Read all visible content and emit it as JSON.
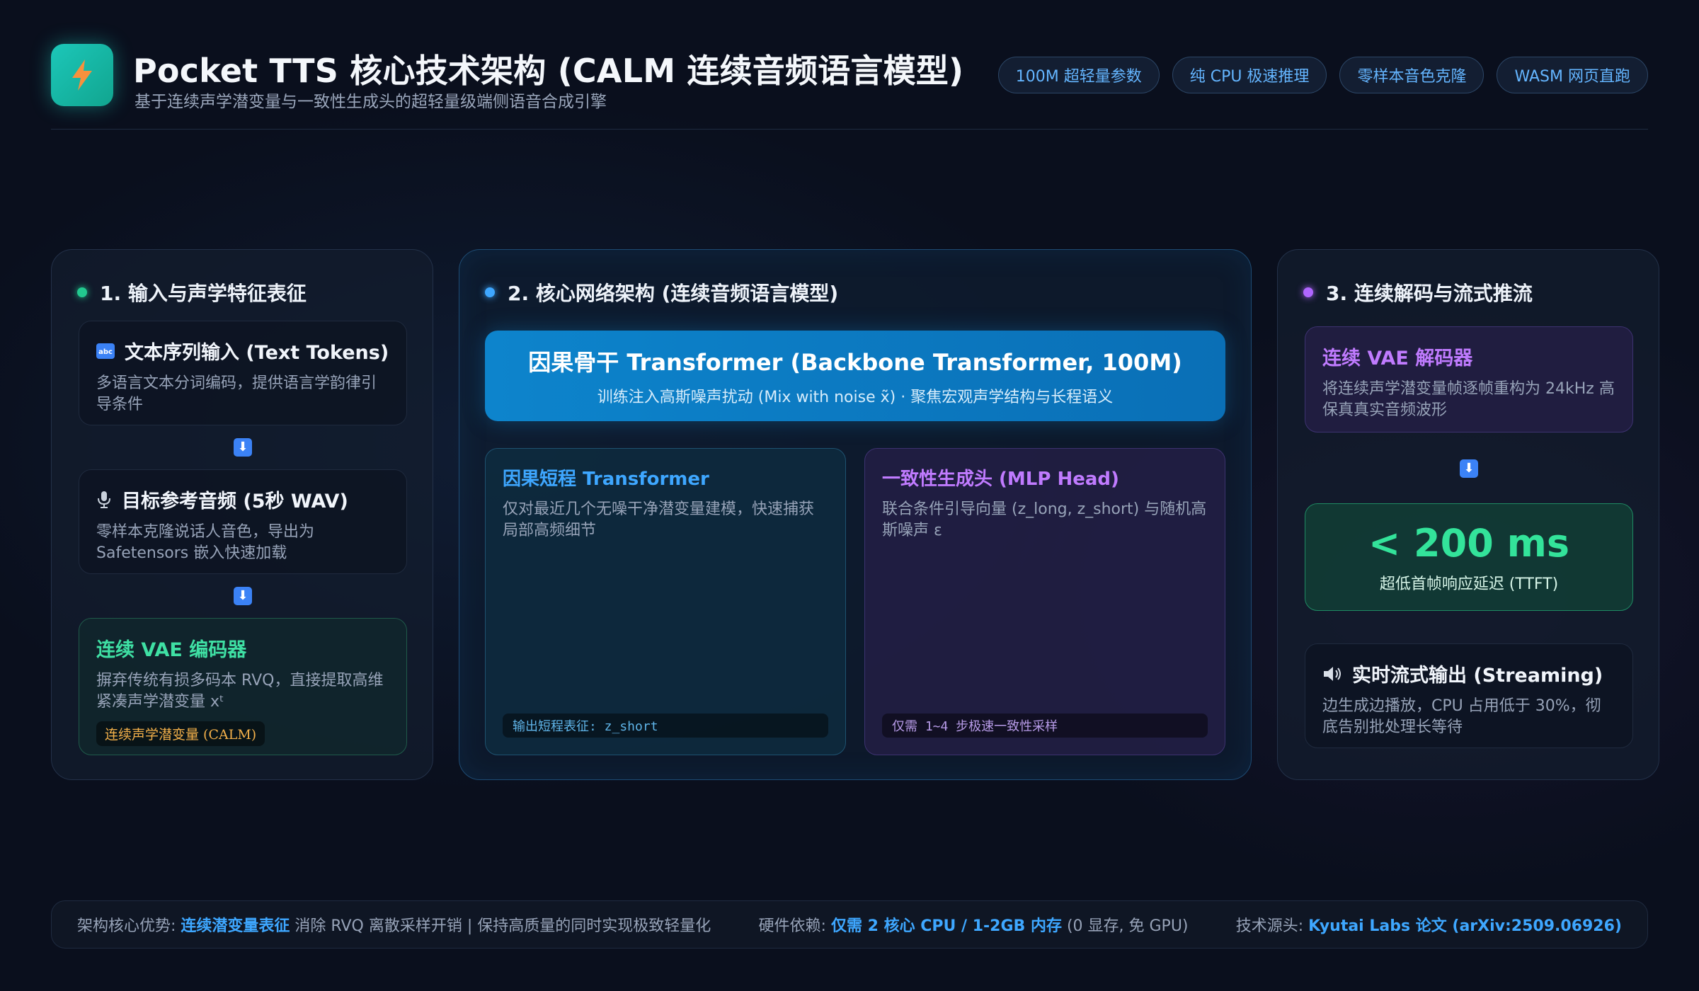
{
  "header": {
    "logo_icon": "lightning-icon",
    "title": "Pocket TTS 核心技术架构 (CALM 连续音频语言模型)",
    "subtitle": "基于连续声学潜变量与一致性生成头的超轻量级端侧语音合成引擎",
    "pills": [
      "100M 超轻量参数",
      "纯 CPU 极速推理",
      "零样本音色克隆",
      "WASM 网页直跑"
    ]
  },
  "col1": {
    "title": "1. 输入与声学特征表征",
    "text_card": {
      "icon": "abc-icon",
      "title": "文本序列输入 (Text Tokens)",
      "desc": "多语言文本分词编码，提供语言学韵律引导条件"
    },
    "ref_card": {
      "icon": "microphone-icon",
      "title": "目标参考音频 (5秒 WAV)",
      "desc": "零样本克隆说话人音色，导出为 Safetensors 嵌入快速加载"
    },
    "vae_card": {
      "title": "连续 VAE 编码器",
      "desc": "摒弃传统有损多码本 RVQ，直接提取高维紧凑声学潜变量 xᵗ",
      "tag": "连续声学潜变量 (CALM)"
    }
  },
  "col2": {
    "title": "2. 核心网络架构 (连续音频语言模型)",
    "backbone": {
      "title": "因果骨干 Transformer (Backbone Transformer, 100M)",
      "desc": "训练注入高斯噪声扰动 (Mix with noise x̃) · 聚焦宏观声学结构与长程语义"
    },
    "short": {
      "title": "因果短程 Transformer",
      "desc": "仅对最近几个无噪干净潜变量建模，快速捕获局部高频细节",
      "note": "输出短程表征: z_short"
    },
    "head": {
      "title": "一致性生成头 (MLP Head)",
      "desc": "联合条件引导向量 (z_long, z_short) 与随机高斯噪声 ε",
      "note": "仅需 1~4 步极速一致性采样"
    }
  },
  "col3": {
    "title": "3. 连续解码与流式推流",
    "decoder": {
      "title": "连续 VAE 解码器",
      "desc": "将连续声学潜变量帧逐帧重构为 24kHz 高保真真实音频波形"
    },
    "latency": {
      "value": "< 200 ms",
      "label": "超低首帧响应延迟 (TTFT)"
    },
    "stream": {
      "icon": "speaker-icon",
      "title": "实时流式输出 (Streaming)",
      "desc": "边生成边播放，CPU 占用低于 30%，彻底告别批处理长等待"
    }
  },
  "footer": {
    "a_prefix": "架构核心优势: ",
    "a_bold": "连续潜变量表征",
    "a_rest": " 消除 RVQ 离散采样开销 | 保持高质量的同时实现极致轻量化",
    "b_prefix": "硬件依赖: ",
    "b_bold": "仅需 2 核心 CPU / 1-2GB 内存",
    "b_rest": " (0 显存, 免 GPU)",
    "c_prefix": "技术源头: ",
    "c_bold": "Kyutai Labs 论文 (arXiv:2509.06926)"
  },
  "colors": {
    "green": "#22c98f",
    "blue": "#3ea7ff",
    "purple": "#b066ff",
    "arrow": "#3b82f6"
  }
}
